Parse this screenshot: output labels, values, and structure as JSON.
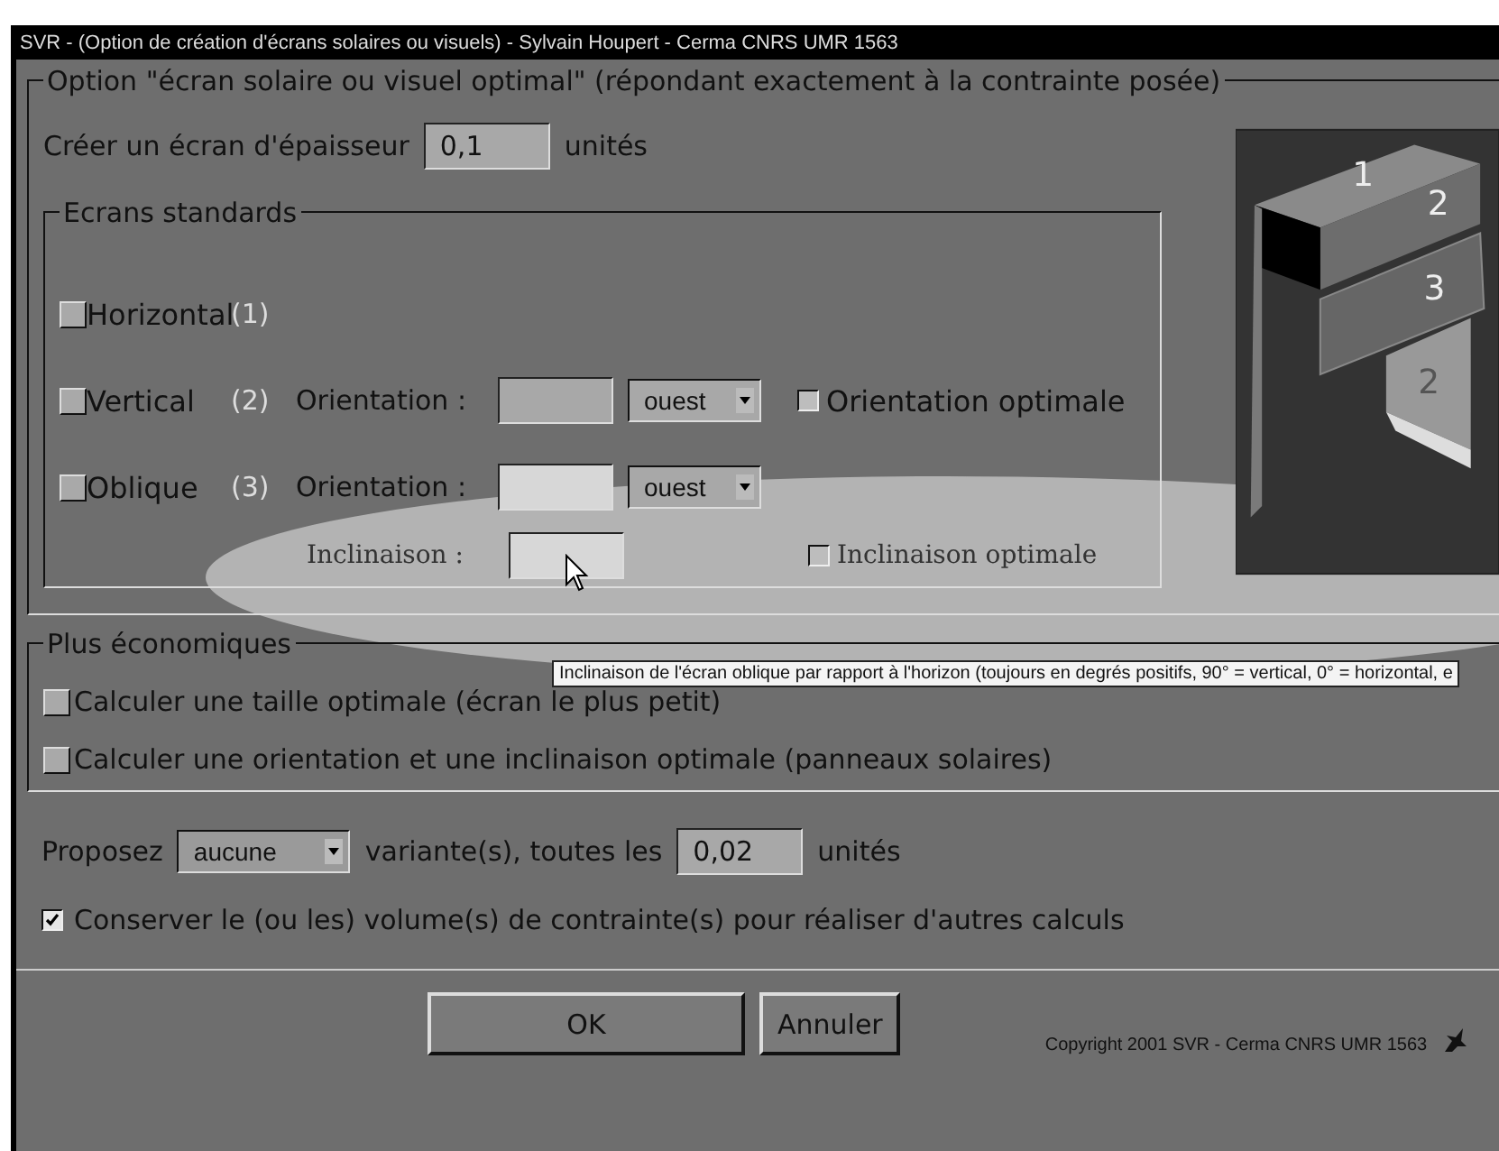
{
  "window": {
    "title": "SVR - (Option de création d'écrans solaires ou visuels) - Sylvain Houpert - Cerma CNRS UMR 1563"
  },
  "optimal_group": {
    "legend": "Option \"écran solaire ou visuel optimal\" (répondant exactement à la contrainte posée)",
    "thickness_label": "Créer un écran d'épaisseur",
    "thickness_value": "0,1",
    "thickness_unit": "unités"
  },
  "standard_group": {
    "legend": "Ecrans standards",
    "screens": [
      {
        "kind": "plain",
        "label": "Horizontal",
        "number": "(1)",
        "checked": false
      },
      {
        "kind": "oriented",
        "label": "Vertical",
        "number": "(2)",
        "checked": false,
        "orientation_label": "Orientation :",
        "direction": "ouest",
        "optimal_label": "Orientation optimale",
        "optimal_checked": false
      },
      {
        "kind": "inclined",
        "label": "Oblique",
        "number": "(3)",
        "checked": false,
        "orientation_label": "Orientation :",
        "direction": "ouest",
        "inclination_label": "Inclinaison :",
        "optimal_label": "Inclinaison optimale",
        "optimal_checked": false
      }
    ]
  },
  "picture_labels": [
    "1",
    "2",
    "3",
    "2"
  ],
  "tooltip": "Inclinaison de l'écran oblique par rapport à l'horizon (toujours en degrés positifs, 90° = vertical, 0° = horizontal, e",
  "economic_group": {
    "legend": "Plus économiques",
    "options": [
      {
        "label": "Calculer une taille optimale (écran le plus petit)",
        "checked": false
      },
      {
        "label": "Calculer une orientation et une inclinaison optimale (panneaux solaires)",
        "checked": false
      }
    ]
  },
  "variants": {
    "label": "Proposez",
    "value": "aucune",
    "middle": "variante(s), toutes les",
    "step": "0,02",
    "unit": "unités"
  },
  "keep_volumes": {
    "label": "Conserver le (ou les) volume(s) de contrainte(s) pour réaliser d'autres calculs",
    "checked": true
  },
  "buttons": [
    {
      "label": "OK"
    },
    {
      "label": "Annuler"
    }
  ],
  "copyright": "Copyright 2001 SVR - Cerma CNRS UMR 1563"
}
